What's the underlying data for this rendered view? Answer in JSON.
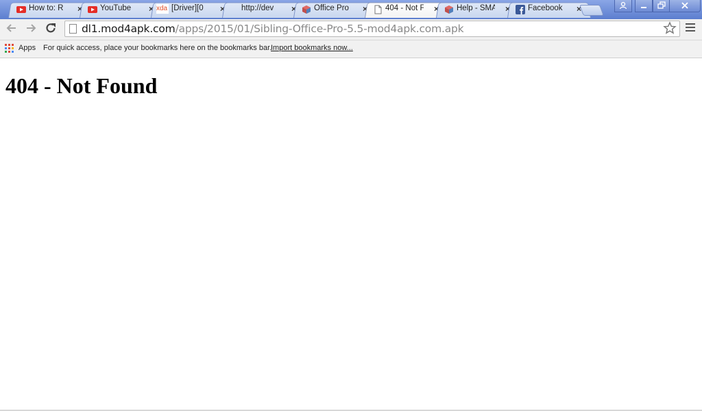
{
  "tabs": [
    {
      "label": "How to: R",
      "icon": "youtube-icon"
    },
    {
      "label": "YouTube",
      "icon": "youtube-icon"
    },
    {
      "label": "[Driver][0",
      "icon": "xda-icon"
    },
    {
      "label": "http://dev",
      "icon": "none"
    },
    {
      "label": "Office Pro",
      "icon": "cube-icon"
    },
    {
      "label": "404 - Not F",
      "icon": "page-icon",
      "active": true
    },
    {
      "label": "Help - SMA",
      "icon": "cube-icon"
    },
    {
      "label": "Facebook",
      "icon": "facebook-icon"
    }
  ],
  "tab_close_glyph": "×",
  "xda_text": "xda",
  "url": {
    "domain": "dl1.mod4apk.com",
    "path": "/apps/2015/01/Sibling-Office-Pro-5.5-mod4apk.com.apk"
  },
  "bookmarks": {
    "apps_label": "Apps",
    "hint": "For quick access, place your bookmarks here on the bookmarks bar.",
    "import_link": "Import bookmarks now..."
  },
  "page": {
    "heading": "404 - Not Found"
  },
  "colors": {
    "titlebar": "#6b8cd6",
    "youtube_red": "#e52d27",
    "facebook_blue": "#3b5998"
  }
}
